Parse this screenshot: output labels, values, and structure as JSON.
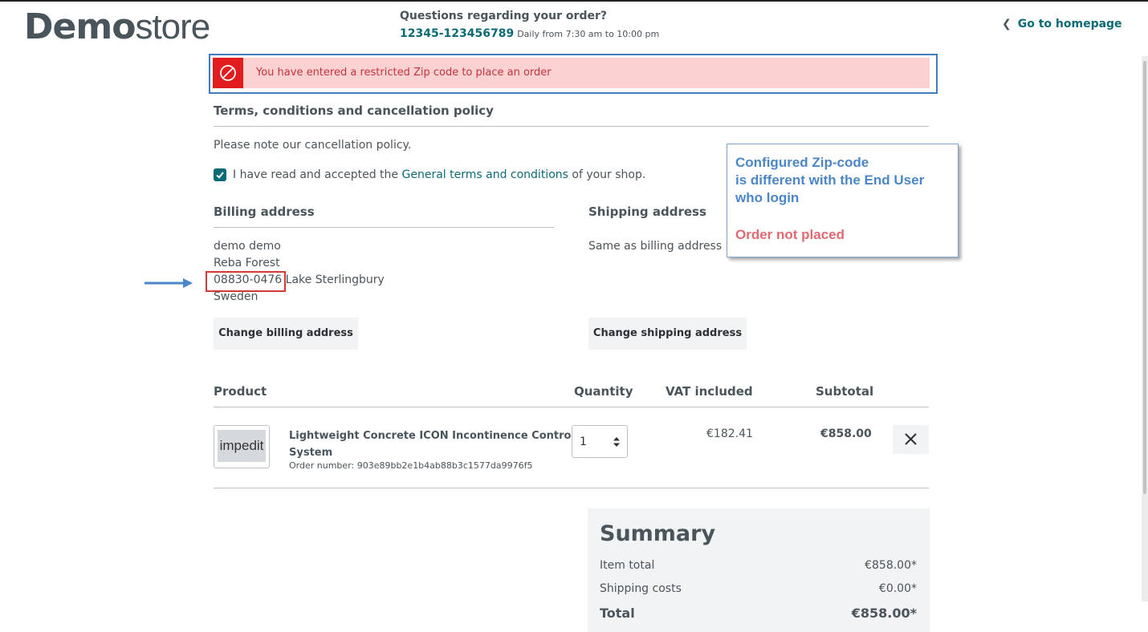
{
  "header": {
    "logo_bold": "Demo",
    "logo_light": "store",
    "questions_title": "Questions regarding your order?",
    "phone": "12345-123456789",
    "hours": "Daily from 7:30 am to 10:00 pm",
    "home_link": "Go to homepage"
  },
  "alert": {
    "message": "You have entered a restricted Zip code to place an order",
    "color": "#e31d1d"
  },
  "terms": {
    "title": "Terms, conditions and cancellation policy",
    "cancellation_link": "Please note our cancellation policy.",
    "checkbox_prefix": "I have read and accepted the",
    "checkbox_link": "General terms and conditions",
    "checkbox_suffix": "of your shop.",
    "checked": true
  },
  "callout": {
    "line1": "Configured Zip-code",
    "line2": "is different with the End User",
    "line3": "who login",
    "line4": "Order not placed"
  },
  "billing": {
    "title": "Billing address",
    "name": "demo demo",
    "street": "Reba Forest",
    "zip": "08830-0476",
    "city": "Lake Sterlingbury",
    "country": "Sweden",
    "button": "Change billing address"
  },
  "shipping": {
    "title": "Shipping address",
    "same_text": "Same as billing address",
    "button": "Change shipping address"
  },
  "table": {
    "headers": [
      "Product",
      "Quantity",
      "VAT included",
      "Subtotal"
    ],
    "item": {
      "thumb_text": "impedit",
      "name_line1": "Lightweight Concrete ICON Incontinence Control",
      "name_line2": "System",
      "order_number": "Order number: 903e89bb2e1b4ab88b3c1577da9976f5",
      "quantity": "1",
      "vat": "€182.41",
      "subtotal": "€858.00"
    }
  },
  "summary": {
    "title": "Summary",
    "rows": [
      {
        "label": "Item total",
        "value": "€858.00*"
      },
      {
        "label": "Shipping costs",
        "value": "€0.00*"
      }
    ],
    "total_label": "Total",
    "total_value": "€858.00*"
  }
}
